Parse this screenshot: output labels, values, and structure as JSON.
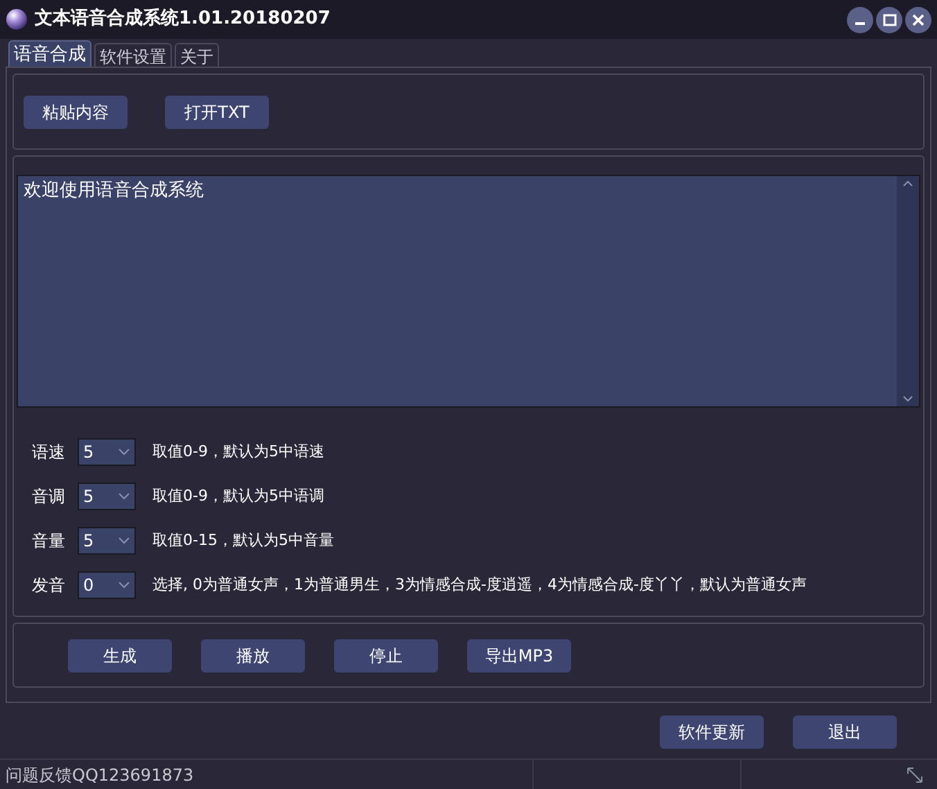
{
  "window": {
    "title": "文本语音合成系统1.01.20180207"
  },
  "tabs": [
    {
      "label": "语音合成",
      "selected": true
    },
    {
      "label": "软件设置",
      "selected": false
    },
    {
      "label": "关于",
      "selected": false
    }
  ],
  "top_buttons": [
    "粘贴内容",
    "打开TXT"
  ],
  "text_area": {
    "value": "欢迎使用语音合成系统"
  },
  "settings": [
    {
      "label": "语速",
      "value": "5",
      "hint": "取值0-9，默认为5中语速"
    },
    {
      "label": "音调",
      "value": "5",
      "hint": "取值0-9，默认为5中语调"
    },
    {
      "label": "音量",
      "value": "5",
      "hint": "取值0-15，默认为5中音量"
    },
    {
      "label": "发音",
      "value": "0",
      "hint": "选择, 0为普通女声，1为普通男生，3为情感合成-度逍遥，4为情感合成-度丫丫，默认为普通女声"
    }
  ],
  "action_buttons": [
    "生成",
    "播放",
    "停止",
    "导出MP3"
  ],
  "footer_buttons": [
    "软件更新",
    "退出"
  ],
  "status_bar": {
    "text": "问题反馈QQ123691873"
  }
}
